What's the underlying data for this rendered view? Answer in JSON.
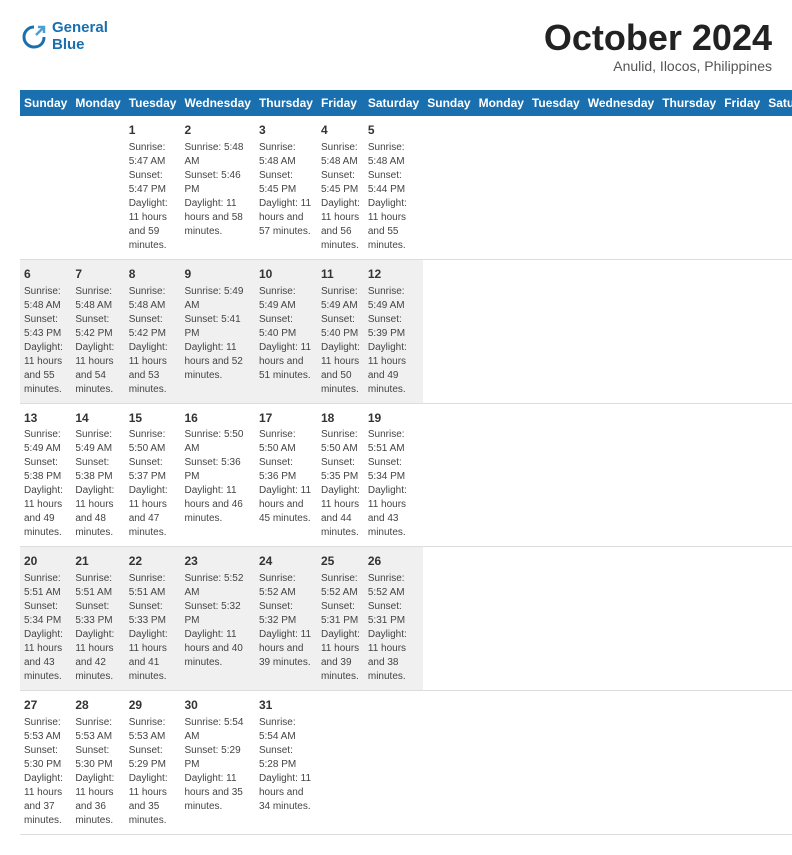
{
  "header": {
    "logo_line1": "General",
    "logo_line2": "Blue",
    "month": "October 2024",
    "location": "Anulid, Ilocos, Philippines"
  },
  "days_of_week": [
    "Sunday",
    "Monday",
    "Tuesday",
    "Wednesday",
    "Thursday",
    "Friday",
    "Saturday"
  ],
  "weeks": [
    [
      {
        "day": "",
        "info": ""
      },
      {
        "day": "",
        "info": ""
      },
      {
        "day": "1",
        "info": "Sunrise: 5:47 AM\nSunset: 5:47 PM\nDaylight: 11 hours and 59 minutes."
      },
      {
        "day": "2",
        "info": "Sunrise: 5:48 AM\nSunset: 5:46 PM\nDaylight: 11 hours and 58 minutes."
      },
      {
        "day": "3",
        "info": "Sunrise: 5:48 AM\nSunset: 5:45 PM\nDaylight: 11 hours and 57 minutes."
      },
      {
        "day": "4",
        "info": "Sunrise: 5:48 AM\nSunset: 5:45 PM\nDaylight: 11 hours and 56 minutes."
      },
      {
        "day": "5",
        "info": "Sunrise: 5:48 AM\nSunset: 5:44 PM\nDaylight: 11 hours and 55 minutes."
      }
    ],
    [
      {
        "day": "6",
        "info": "Sunrise: 5:48 AM\nSunset: 5:43 PM\nDaylight: 11 hours and 55 minutes."
      },
      {
        "day": "7",
        "info": "Sunrise: 5:48 AM\nSunset: 5:42 PM\nDaylight: 11 hours and 54 minutes."
      },
      {
        "day": "8",
        "info": "Sunrise: 5:48 AM\nSunset: 5:42 PM\nDaylight: 11 hours and 53 minutes."
      },
      {
        "day": "9",
        "info": "Sunrise: 5:49 AM\nSunset: 5:41 PM\nDaylight: 11 hours and 52 minutes."
      },
      {
        "day": "10",
        "info": "Sunrise: 5:49 AM\nSunset: 5:40 PM\nDaylight: 11 hours and 51 minutes."
      },
      {
        "day": "11",
        "info": "Sunrise: 5:49 AM\nSunset: 5:40 PM\nDaylight: 11 hours and 50 minutes."
      },
      {
        "day": "12",
        "info": "Sunrise: 5:49 AM\nSunset: 5:39 PM\nDaylight: 11 hours and 49 minutes."
      }
    ],
    [
      {
        "day": "13",
        "info": "Sunrise: 5:49 AM\nSunset: 5:38 PM\nDaylight: 11 hours and 49 minutes."
      },
      {
        "day": "14",
        "info": "Sunrise: 5:49 AM\nSunset: 5:38 PM\nDaylight: 11 hours and 48 minutes."
      },
      {
        "day": "15",
        "info": "Sunrise: 5:50 AM\nSunset: 5:37 PM\nDaylight: 11 hours and 47 minutes."
      },
      {
        "day": "16",
        "info": "Sunrise: 5:50 AM\nSunset: 5:36 PM\nDaylight: 11 hours and 46 minutes."
      },
      {
        "day": "17",
        "info": "Sunrise: 5:50 AM\nSunset: 5:36 PM\nDaylight: 11 hours and 45 minutes."
      },
      {
        "day": "18",
        "info": "Sunrise: 5:50 AM\nSunset: 5:35 PM\nDaylight: 11 hours and 44 minutes."
      },
      {
        "day": "19",
        "info": "Sunrise: 5:51 AM\nSunset: 5:34 PM\nDaylight: 11 hours and 43 minutes."
      }
    ],
    [
      {
        "day": "20",
        "info": "Sunrise: 5:51 AM\nSunset: 5:34 PM\nDaylight: 11 hours and 43 minutes."
      },
      {
        "day": "21",
        "info": "Sunrise: 5:51 AM\nSunset: 5:33 PM\nDaylight: 11 hours and 42 minutes."
      },
      {
        "day": "22",
        "info": "Sunrise: 5:51 AM\nSunset: 5:33 PM\nDaylight: 11 hours and 41 minutes."
      },
      {
        "day": "23",
        "info": "Sunrise: 5:52 AM\nSunset: 5:32 PM\nDaylight: 11 hours and 40 minutes."
      },
      {
        "day": "24",
        "info": "Sunrise: 5:52 AM\nSunset: 5:32 PM\nDaylight: 11 hours and 39 minutes."
      },
      {
        "day": "25",
        "info": "Sunrise: 5:52 AM\nSunset: 5:31 PM\nDaylight: 11 hours and 39 minutes."
      },
      {
        "day": "26",
        "info": "Sunrise: 5:52 AM\nSunset: 5:31 PM\nDaylight: 11 hours and 38 minutes."
      }
    ],
    [
      {
        "day": "27",
        "info": "Sunrise: 5:53 AM\nSunset: 5:30 PM\nDaylight: 11 hours and 37 minutes."
      },
      {
        "day": "28",
        "info": "Sunrise: 5:53 AM\nSunset: 5:30 PM\nDaylight: 11 hours and 36 minutes."
      },
      {
        "day": "29",
        "info": "Sunrise: 5:53 AM\nSunset: 5:29 PM\nDaylight: 11 hours and 35 minutes."
      },
      {
        "day": "30",
        "info": "Sunrise: 5:54 AM\nSunset: 5:29 PM\nDaylight: 11 hours and 35 minutes."
      },
      {
        "day": "31",
        "info": "Sunrise: 5:54 AM\nSunset: 5:28 PM\nDaylight: 11 hours and 34 minutes."
      },
      {
        "day": "",
        "info": ""
      },
      {
        "day": "",
        "info": ""
      }
    ]
  ]
}
